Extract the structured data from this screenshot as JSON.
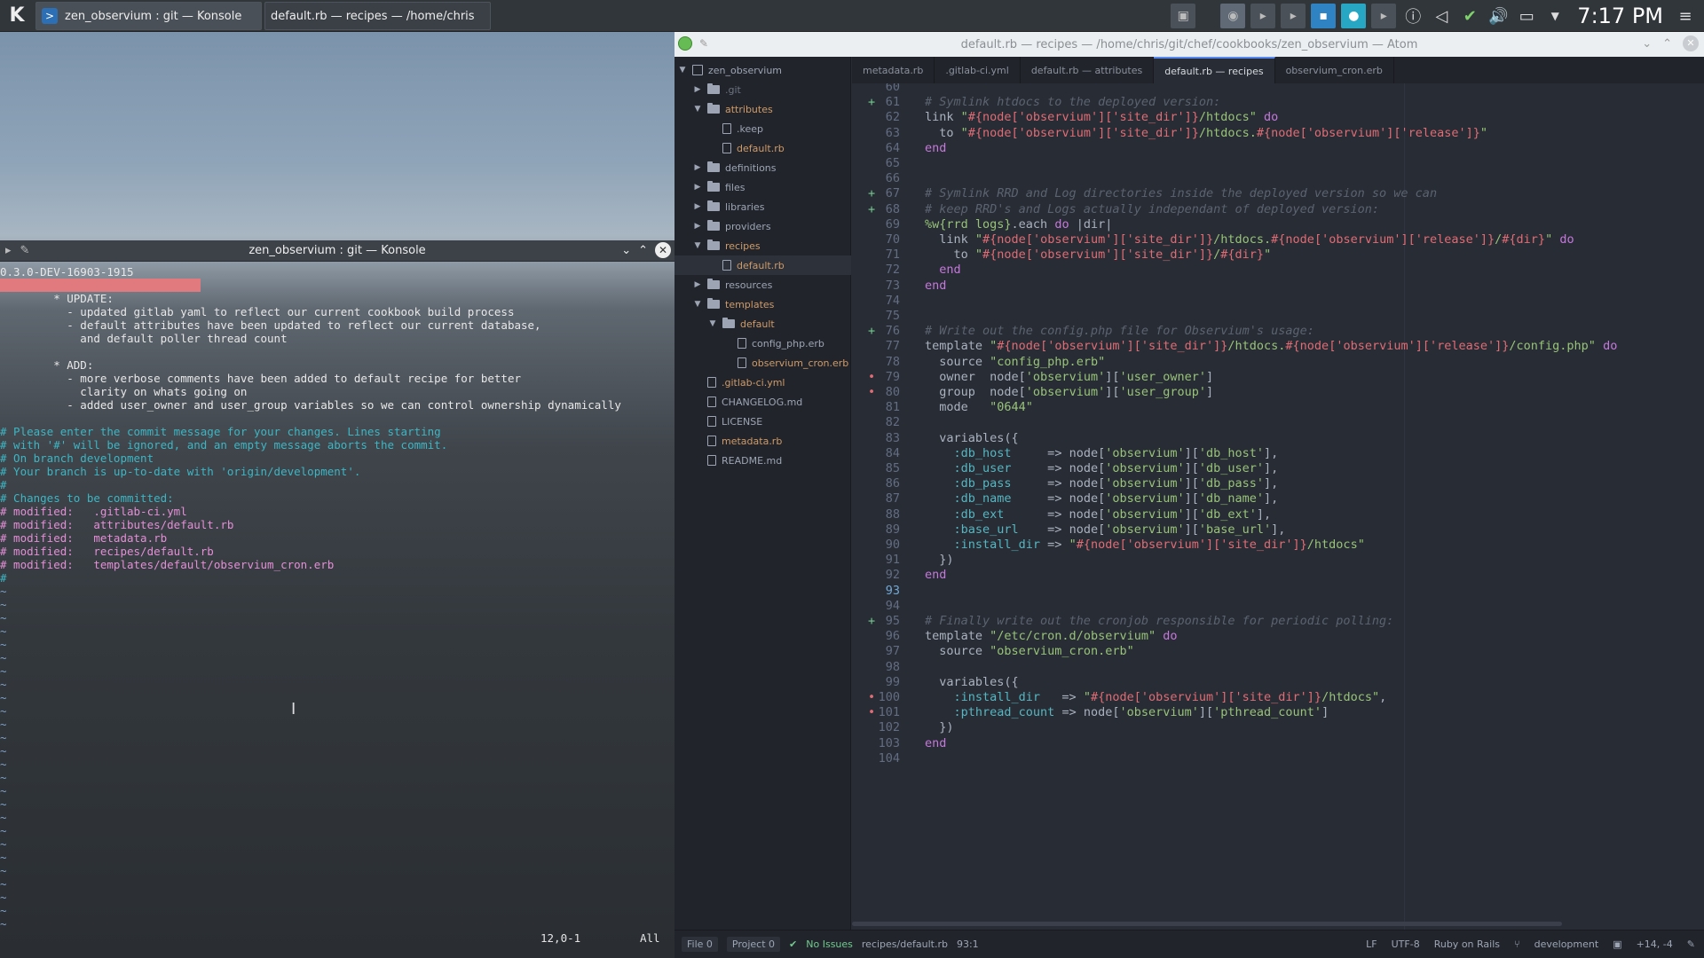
{
  "taskbar": {
    "tasks": [
      {
        "label": "zen_observium : git — Konsole"
      },
      {
        "label": "default.rb — recipes — /home/chris"
      }
    ],
    "clock": "7:17 PM"
  },
  "konsole": {
    "title": "zen_observium : git — Konsole",
    "lines": [
      {
        "text": "0.3.0-DEV-16903-1915",
        "cls": "t-kw"
      },
      {
        "text": "------------------------------",
        "cls": "t-err"
      },
      {
        "text": "        * UPDATE:",
        "cls": "t-kw"
      },
      {
        "text": "          - updated gitlab yaml to reflect our current cookbook build process",
        "cls": "t-kw"
      },
      {
        "text": "          - default attributes have been updated to reflect our current database,",
        "cls": "t-kw"
      },
      {
        "text": "            and default poller thread count",
        "cls": "t-kw"
      },
      {
        "text": "",
        "cls": "t-kw"
      },
      {
        "text": "        * ADD:",
        "cls": "t-kw"
      },
      {
        "text": "          - more verbose comments have been added to default recipe for better",
        "cls": "t-kw"
      },
      {
        "text": "            clarity on whats going on",
        "cls": "t-kw"
      },
      {
        "text": "          - added user_owner and user_group variables so we can control ownership dynamically",
        "cls": "t-kw"
      },
      {
        "text": "",
        "cls": "t-kw"
      },
      {
        "text": "# Please enter the commit message for your changes. Lines starting",
        "cls": "t-cmt"
      },
      {
        "text": "# with '#' will be ignored, and an empty message aborts the commit.",
        "cls": "t-cmt"
      },
      {
        "text": "# On branch development",
        "cls": "t-cmt"
      },
      {
        "text": "# Your branch is up-to-date with 'origin/development'.",
        "cls": "t-cmt"
      },
      {
        "text": "#",
        "cls": "t-cmt"
      },
      {
        "text": "# Changes to be committed:",
        "cls": "t-cmt"
      },
      {
        "text": "# modified:   .gitlab-ci.yml",
        "cls": "t-mod"
      },
      {
        "text": "# modified:   attributes/default.rb",
        "cls": "t-mod"
      },
      {
        "text": "# modified:   metadata.rb",
        "cls": "t-mod"
      },
      {
        "text": "# modified:   recipes/default.rb",
        "cls": "t-mod"
      },
      {
        "text": "# modified:   templates/default/observium_cron.erb",
        "cls": "t-mod"
      },
      {
        "text": "#",
        "cls": "t-cmt"
      }
    ],
    "tilde_count": 26,
    "position": "12,0-1",
    "scroll": "All"
  },
  "atom": {
    "title": "default.rb — recipes — /home/chris/git/chef/cookbooks/zen_observium — Atom",
    "tree": [
      {
        "label": "zen_observium",
        "depth": 0,
        "kind": "repo",
        "chev": "v"
      },
      {
        "label": ".git",
        "depth": 1,
        "kind": "folder",
        "chev": ">",
        "cls": "t-dim"
      },
      {
        "label": "attributes",
        "depth": 1,
        "kind": "folder",
        "chev": "v",
        "cls": "t-orange"
      },
      {
        "label": ".keep",
        "depth": 2,
        "kind": "file",
        "chev": ""
      },
      {
        "label": "default.rb",
        "depth": 2,
        "kind": "file",
        "chev": "",
        "cls": "t-orange"
      },
      {
        "label": "definitions",
        "depth": 1,
        "kind": "folder",
        "chev": ">"
      },
      {
        "label": "files",
        "depth": 1,
        "kind": "folder",
        "chev": ">"
      },
      {
        "label": "libraries",
        "depth": 1,
        "kind": "folder",
        "chev": ">"
      },
      {
        "label": "providers",
        "depth": 1,
        "kind": "folder",
        "chev": ">"
      },
      {
        "label": "recipes",
        "depth": 1,
        "kind": "folder",
        "chev": "v",
        "cls": "t-orange"
      },
      {
        "label": "default.rb",
        "depth": 2,
        "kind": "file",
        "chev": "",
        "cls": "t-orange",
        "selected": true
      },
      {
        "label": "resources",
        "depth": 1,
        "kind": "folder",
        "chev": ">"
      },
      {
        "label": "templates",
        "depth": 1,
        "kind": "folder",
        "chev": "v",
        "cls": "t-orange"
      },
      {
        "label": "default",
        "depth": 2,
        "kind": "folder",
        "chev": "v",
        "cls": "t-orange"
      },
      {
        "label": "config_php.erb",
        "depth": 3,
        "kind": "file",
        "chev": ""
      },
      {
        "label": "observium_cron.erb",
        "depth": 3,
        "kind": "file",
        "chev": "",
        "cls": "t-orange"
      },
      {
        "label": ".gitlab-ci.yml",
        "depth": 1,
        "kind": "file",
        "chev": "",
        "cls": "t-orange"
      },
      {
        "label": "CHANGELOG.md",
        "depth": 1,
        "kind": "file",
        "chev": ""
      },
      {
        "label": "LICENSE",
        "depth": 1,
        "kind": "file",
        "chev": ""
      },
      {
        "label": "metadata.rb",
        "depth": 1,
        "kind": "file",
        "chev": "",
        "cls": "t-orange"
      },
      {
        "label": "README.md",
        "depth": 1,
        "kind": "file",
        "chev": ""
      }
    ],
    "tabs": [
      {
        "label": "metadata.rb",
        "active": false
      },
      {
        "label": ".gitlab-ci.yml",
        "active": false
      },
      {
        "label": "default.rb — attributes",
        "active": false
      },
      {
        "label": "default.rb — recipes",
        "active": true
      },
      {
        "label": "observium_cron.erb",
        "active": false
      }
    ],
    "code": [
      {
        "n": "60",
        "mark": "",
        "t": [
          [
            "c-txt",
            ""
          ]
        ]
      },
      {
        "n": "61",
        "mark": "+",
        "t": [
          [
            "c-com",
            "# Symlink htdocs to the deployed version:"
          ]
        ]
      },
      {
        "n": "62",
        "mark": "",
        "t": [
          [
            "c-txt",
            "link "
          ],
          [
            "c-str",
            "\""
          ],
          [
            "c-int",
            "#{node['observium']['site_dir']}"
          ],
          [
            "c-str",
            "/htdocs\""
          ],
          [
            "c-kw",
            " do"
          ]
        ]
      },
      {
        "n": "63",
        "mark": "",
        "t": [
          [
            "c-txt",
            "  to "
          ],
          [
            "c-str",
            "\""
          ],
          [
            "c-int",
            "#{node['observium']['site_dir']}"
          ],
          [
            "c-str",
            "/htdocs."
          ],
          [
            "c-int",
            "#{node['observium']['release']}"
          ],
          [
            "c-str",
            "\""
          ]
        ]
      },
      {
        "n": "64",
        "mark": "",
        "t": [
          [
            "c-kw",
            "end"
          ]
        ]
      },
      {
        "n": "65",
        "mark": "",
        "t": [
          [
            "c-txt",
            ""
          ]
        ]
      },
      {
        "n": "66",
        "mark": "",
        "t": [
          [
            "c-txt",
            ""
          ]
        ]
      },
      {
        "n": "67",
        "mark": "+",
        "t": [
          [
            "c-com",
            "# Symlink RRD and Log directories inside the deployed version so we can"
          ]
        ]
      },
      {
        "n": "68",
        "mark": "+",
        "t": [
          [
            "c-com",
            "# keep RRD's and Logs actually independant of deployed version:"
          ]
        ]
      },
      {
        "n": "69",
        "mark": "",
        "t": [
          [
            "c-str",
            "%w{rrd logs}"
          ],
          [
            "c-txt",
            ".each "
          ],
          [
            "c-kw",
            "do"
          ],
          [
            "c-txt",
            " |dir|"
          ]
        ]
      },
      {
        "n": "70",
        "mark": "",
        "t": [
          [
            "c-txt",
            "  link "
          ],
          [
            "c-str",
            "\""
          ],
          [
            "c-int",
            "#{node['observium']['site_dir']}"
          ],
          [
            "c-str",
            "/htdocs."
          ],
          [
            "c-int",
            "#{node['observium']['release']}"
          ],
          [
            "c-str",
            "/"
          ],
          [
            "c-int",
            "#{dir}"
          ],
          [
            "c-str",
            "\""
          ],
          [
            "c-kw",
            " do"
          ]
        ]
      },
      {
        "n": "71",
        "mark": "",
        "t": [
          [
            "c-txt",
            "    to "
          ],
          [
            "c-str",
            "\""
          ],
          [
            "c-int",
            "#{node['observium']['site_dir']}"
          ],
          [
            "c-str",
            "/"
          ],
          [
            "c-int",
            "#{dir}"
          ],
          [
            "c-str",
            "\""
          ]
        ]
      },
      {
        "n": "72",
        "mark": "",
        "t": [
          [
            "c-kw",
            "  end"
          ]
        ]
      },
      {
        "n": "73",
        "mark": "",
        "t": [
          [
            "c-kw",
            "end"
          ]
        ]
      },
      {
        "n": "74",
        "mark": "",
        "t": [
          [
            "c-txt",
            ""
          ]
        ]
      },
      {
        "n": "75",
        "mark": "",
        "t": [
          [
            "c-txt",
            ""
          ]
        ]
      },
      {
        "n": "76",
        "mark": "+",
        "t": [
          [
            "c-com",
            "# Write out the config.php file for Observium's usage:"
          ]
        ]
      },
      {
        "n": "77",
        "mark": "",
        "t": [
          [
            "c-txt",
            "template "
          ],
          [
            "c-str",
            "\""
          ],
          [
            "c-int",
            "#{node['observium']['site_dir']}"
          ],
          [
            "c-str",
            "/htdocs."
          ],
          [
            "c-int",
            "#{node['observium']['release']}"
          ],
          [
            "c-str",
            "/config.php\""
          ],
          [
            "c-kw",
            " do"
          ]
        ]
      },
      {
        "n": "78",
        "mark": "",
        "t": [
          [
            "c-txt",
            "  source "
          ],
          [
            "c-str",
            "\"config_php.erb\""
          ]
        ]
      },
      {
        "n": "79",
        "mark": "•",
        "t": [
          [
            "c-txt",
            "  owner  node["
          ],
          [
            "c-str",
            "'observium'"
          ],
          [
            "c-txt",
            "]["
          ],
          [
            "c-str",
            "'user_owner'"
          ],
          [
            "c-txt",
            "]"
          ]
        ]
      },
      {
        "n": "80",
        "mark": "•",
        "t": [
          [
            "c-txt",
            "  group  node["
          ],
          [
            "c-str",
            "'observium'"
          ],
          [
            "c-txt",
            "]["
          ],
          [
            "c-str",
            "'user_group'"
          ],
          [
            "c-txt",
            "]"
          ]
        ]
      },
      {
        "n": "81",
        "mark": "",
        "t": [
          [
            "c-txt",
            "  mode   "
          ],
          [
            "c-str",
            "\"0644\""
          ]
        ]
      },
      {
        "n": "82",
        "mark": "",
        "t": [
          [
            "c-txt",
            ""
          ]
        ]
      },
      {
        "n": "83",
        "mark": "",
        "t": [
          [
            "c-txt",
            "  variables({"
          ]
        ]
      },
      {
        "n": "84",
        "mark": "",
        "t": [
          [
            "c-sym",
            "    :db_host"
          ],
          [
            "c-txt",
            "     => node["
          ],
          [
            "c-str",
            "'observium'"
          ],
          [
            "c-txt",
            "]["
          ],
          [
            "c-str",
            "'db_host'"
          ],
          [
            "c-txt",
            "],"
          ]
        ]
      },
      {
        "n": "85",
        "mark": "",
        "t": [
          [
            "c-sym",
            "    :db_user"
          ],
          [
            "c-txt",
            "     => node["
          ],
          [
            "c-str",
            "'observium'"
          ],
          [
            "c-txt",
            "]["
          ],
          [
            "c-str",
            "'db_user'"
          ],
          [
            "c-txt",
            "],"
          ]
        ]
      },
      {
        "n": "86",
        "mark": "",
        "t": [
          [
            "c-sym",
            "    :db_pass"
          ],
          [
            "c-txt",
            "     => node["
          ],
          [
            "c-str",
            "'observium'"
          ],
          [
            "c-txt",
            "]["
          ],
          [
            "c-str",
            "'db_pass'"
          ],
          [
            "c-txt",
            "],"
          ]
        ]
      },
      {
        "n": "87",
        "mark": "",
        "t": [
          [
            "c-sym",
            "    :db_name"
          ],
          [
            "c-txt",
            "     => node["
          ],
          [
            "c-str",
            "'observium'"
          ],
          [
            "c-txt",
            "]["
          ],
          [
            "c-str",
            "'db_name'"
          ],
          [
            "c-txt",
            "],"
          ]
        ]
      },
      {
        "n": "88",
        "mark": "",
        "t": [
          [
            "c-sym",
            "    :db_ext"
          ],
          [
            "c-txt",
            "      => node["
          ],
          [
            "c-str",
            "'observium'"
          ],
          [
            "c-txt",
            "]["
          ],
          [
            "c-str",
            "'db_ext'"
          ],
          [
            "c-txt",
            "],"
          ]
        ]
      },
      {
        "n": "89",
        "mark": "",
        "t": [
          [
            "c-sym",
            "    :base_url"
          ],
          [
            "c-txt",
            "    => node["
          ],
          [
            "c-str",
            "'observium'"
          ],
          [
            "c-txt",
            "]["
          ],
          [
            "c-str",
            "'base_url'"
          ],
          [
            "c-txt",
            "],"
          ]
        ]
      },
      {
        "n": "90",
        "mark": "",
        "t": [
          [
            "c-sym",
            "    :install_dir"
          ],
          [
            "c-txt",
            " => "
          ],
          [
            "c-str",
            "\""
          ],
          [
            "c-int",
            "#{node['observium']['site_dir']}"
          ],
          [
            "c-str",
            "/htdocs\""
          ]
        ]
      },
      {
        "n": "91",
        "mark": "",
        "t": [
          [
            "c-txt",
            "  })"
          ]
        ]
      },
      {
        "n": "92",
        "mark": "",
        "t": [
          [
            "c-kw",
            "end"
          ]
        ]
      },
      {
        "n": "93",
        "mark": "",
        "t": [
          [
            "c-txt",
            ""
          ]
        ],
        "cur": true
      },
      {
        "n": "94",
        "mark": "",
        "t": [
          [
            "c-txt",
            ""
          ]
        ]
      },
      {
        "n": "95",
        "mark": "+",
        "t": [
          [
            "c-com",
            "# Finally write out the cronjob responsible for periodic polling:"
          ]
        ]
      },
      {
        "n": "96",
        "mark": "",
        "t": [
          [
            "c-txt",
            "template "
          ],
          [
            "c-str",
            "\"/etc/cron.d/observium\""
          ],
          [
            "c-kw",
            " do"
          ]
        ]
      },
      {
        "n": "97",
        "mark": "",
        "t": [
          [
            "c-txt",
            "  source "
          ],
          [
            "c-str",
            "\"observium_cron.erb\""
          ]
        ]
      },
      {
        "n": "98",
        "mark": "",
        "t": [
          [
            "c-txt",
            ""
          ]
        ]
      },
      {
        "n": "99",
        "mark": "",
        "t": [
          [
            "c-txt",
            "  variables({"
          ]
        ]
      },
      {
        "n": "100",
        "mark": "•",
        "t": [
          [
            "c-sym",
            "    :install_dir"
          ],
          [
            "c-txt",
            "   => "
          ],
          [
            "c-str",
            "\""
          ],
          [
            "c-int",
            "#{node['observium']['site_dir']}"
          ],
          [
            "c-str",
            "/htdocs\""
          ],
          [
            "c-txt",
            ","
          ]
        ]
      },
      {
        "n": "101",
        "mark": "•",
        "t": [
          [
            "c-sym",
            "    :pthread_count"
          ],
          [
            "c-txt",
            " => node["
          ],
          [
            "c-str",
            "'observium'"
          ],
          [
            "c-txt",
            "]["
          ],
          [
            "c-str",
            "'pthread_count'"
          ],
          [
            "c-txt",
            "]"
          ]
        ]
      },
      {
        "n": "102",
        "mark": "",
        "t": [
          [
            "c-txt",
            "  })"
          ]
        ]
      },
      {
        "n": "103",
        "mark": "",
        "t": [
          [
            "c-kw",
            "end"
          ]
        ]
      },
      {
        "n": "104",
        "mark": "",
        "t": [
          [
            "c-txt",
            ""
          ]
        ]
      }
    ],
    "status": {
      "file": "File 0",
      "project": "Project 0",
      "issues": "No Issues",
      "path": "recipes/default.rb",
      "cursor": "93:1",
      "eol": "LF",
      "encoding": "UTF-8",
      "grammar": "Ruby on Rails",
      "branch": "development",
      "diff": "+14, -4"
    }
  },
  "colors": {
    "accent": "#568af2",
    "added": "#73c990",
    "modified": "#e06c75"
  }
}
